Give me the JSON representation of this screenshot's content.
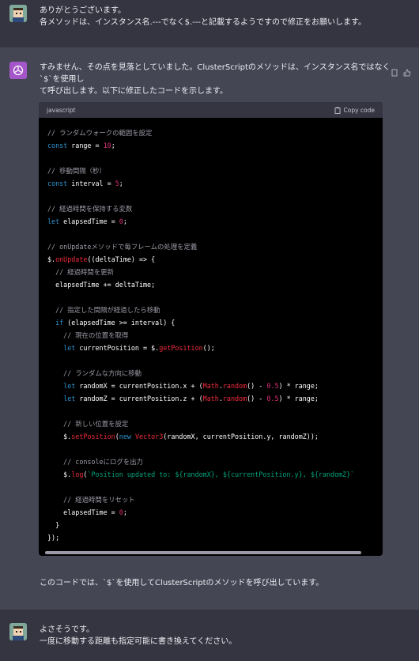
{
  "turns": {
    "user1": {
      "line1": "ありがとうございます。",
      "line2": "各メソッドは、インスタンス名.---でなく$.---と記載するようですので修正をお願いします。"
    },
    "bot": {
      "intro1": "すみません、その点を見落としていました。ClusterScriptのメソッドは、インスタンス名ではなく`$`を使用し",
      "intro2": "て呼び出します。以下に修正したコードを示します。",
      "code_lang": "javascript",
      "copy_label": "Copy code",
      "outro": "このコードでは、`$`を使用してClusterScriptのメソッドを呼び出しています。"
    },
    "user2": {
      "line1": "よさそうです。",
      "line2": "一度に移動する距離も指定可能に書き換えてください。"
    }
  },
  "code": {
    "l1": "// ランダムウォークの範囲を設定",
    "l2a": "const",
    "l2b": " range = ",
    "l2c": "10",
    "l2d": ";",
    "l3": "// 移動間隔（秒）",
    "l4a": "const",
    "l4b": " interval = ",
    "l4c": "5",
    "l4d": ";",
    "l5": "// 経過時間を保持する変数",
    "l6a": "let",
    "l6b": " elapsedTime = ",
    "l6c": "0",
    "l6d": ";",
    "l7": "// onUpdateメソッドで毎フレームの処理を定義",
    "l8a": "$.",
    "l8b": "onUpdate",
    "l8c": "((deltaTime) => {",
    "l9": "  // 経過時間を更新",
    "l10": "  elapsedTime += deltaTime;",
    "l11": "  // 指定した間隔が経過したら移動",
    "l12a": "  if",
    "l12b": " (elapsedTime >= interval) {",
    "l13": "    // 現在の位置を取得",
    "l14a": "    let",
    "l14b": " currentPosition = $.",
    "l14c": "getPosition",
    "l14d": "();",
    "l15": "    // ランダムな方向に移動",
    "l16a": "    let",
    "l16b": " randomX = currentPosition.x + (",
    "l16c": "Math",
    "l16d": ".",
    "l16e": "random",
    "l16f": "() - ",
    "l16g": "0.5",
    "l16h": ") * range;",
    "l17a": "    let",
    "l17b": " randomZ = currentPosition.z + (",
    "l17c": "Math",
    "l17d": ".",
    "l17e": "random",
    "l17f": "() - ",
    "l17g": "0.5",
    "l17h": ") * range;",
    "l18": "    // 新しい位置を設定",
    "l19a": "    $.",
    "l19b": "setPosition",
    "l19c": "(",
    "l19d": "new",
    "l19e": " ",
    "l19f": "Vector3",
    "l19g": "(randomX, currentPosition.y, randomZ));",
    "l20": "    // consoleにログを出力",
    "l21a": "    $.",
    "l21b": "log",
    "l21c": "(",
    "l21d": "`Position updated to: ${randomX}, ${currentPosition.y}, ${randomZ}`",
    "l22": "    // 経過時間をリセット",
    "l23a": "    elapsedTime = ",
    "l23b": "0",
    "l23c": ";",
    "l24": "  }",
    "l25": "});"
  },
  "colors": {
    "user_bg": "#343541",
    "bot_bg": "#444654",
    "code_bg": "#000000",
    "accent": "#a456c9"
  }
}
